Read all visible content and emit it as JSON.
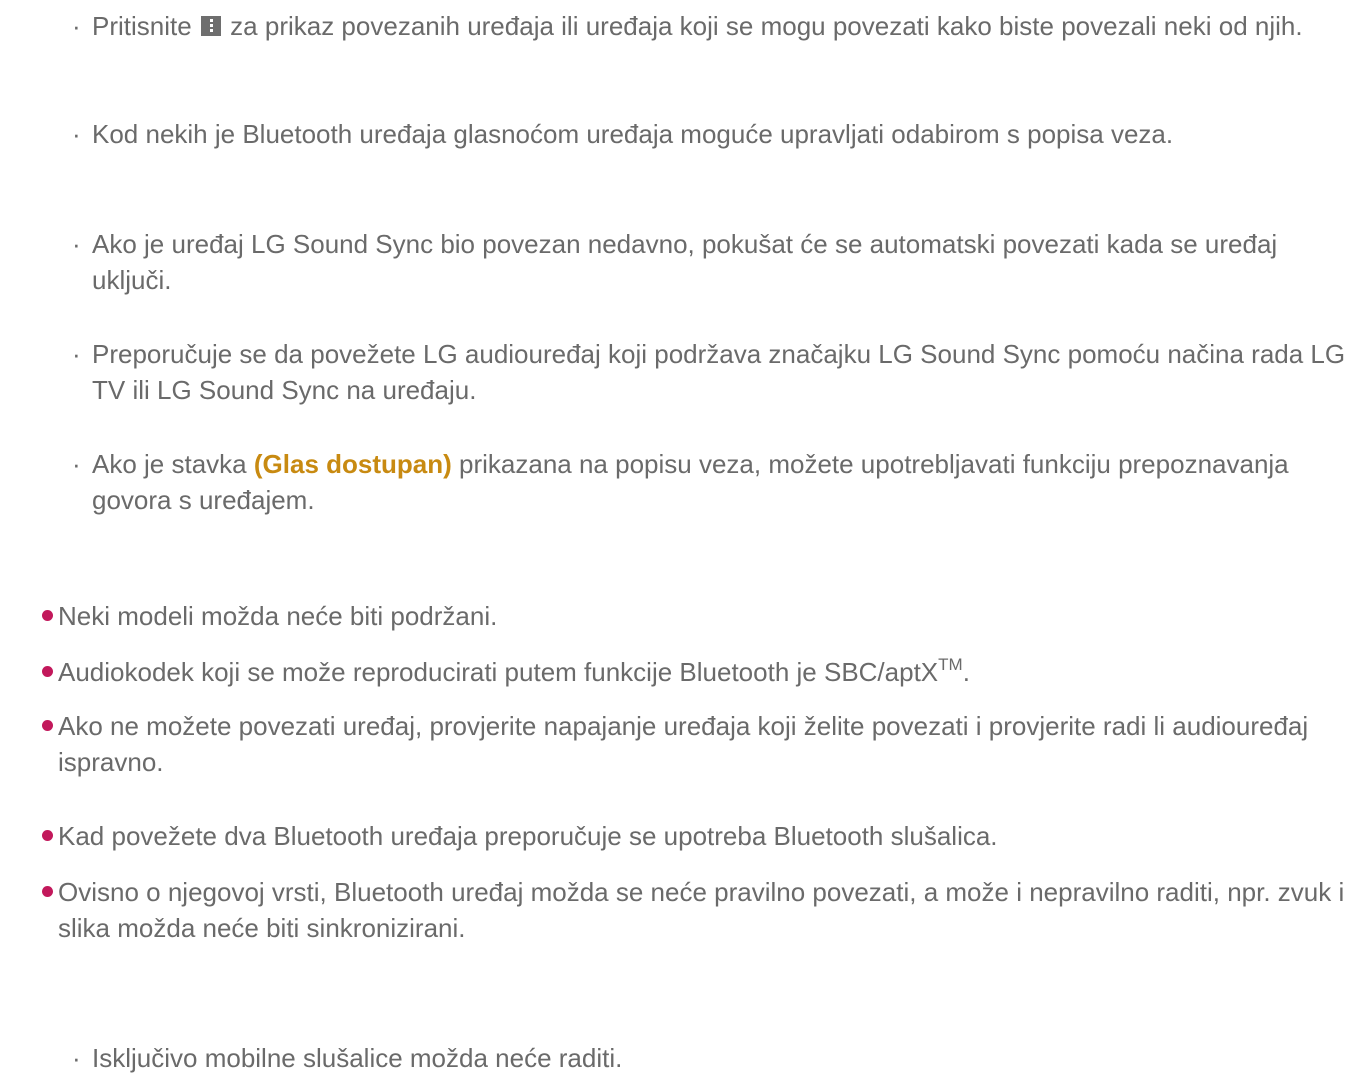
{
  "sub_items_top": [
    {
      "text_before": "Pritisnite",
      "icon": "more-menu-icon",
      "text_after": "za prikaz povezanih uređaja ili uređaja koji se mogu povezati kako biste povezali neki od njih."
    },
    {
      "text": "Kod nekih je Bluetooth uređaja glasnoćom uređaja moguće upravljati odabirom s popisa veza."
    },
    {
      "text": "Ako je uređaj LG Sound Sync bio povezan nedavno, pokušat će se automatski povezati kada se uređaj uključi."
    },
    {
      "text": "Preporučuje se da povežete LG audiouređaj koji podržava značajku LG Sound Sync pomoću načina rada LG TV ili LG Sound Sync na uređaju."
    },
    {
      "text_before": "Ako je stavka",
      "highlight": "(Glas dostupan)",
      "text_after": "prikazana na popisu veza, možete upotrebljavati funkciju prepoznavanja govora s uređajem."
    }
  ],
  "bullet_items": [
    {
      "text": "Neki modeli možda neće biti podržani."
    },
    {
      "text_before": "Audiokodek koji se može reproducirati putem funkcije Bluetooth je SBC/aptX",
      "sup": "TM",
      "text_after": "."
    },
    {
      "text": "Ako ne možete povezati uređaj, provjerite napajanje uređaja koji želite povezati i provjerite radi li audiouređaj ispravno."
    },
    {
      "text": "Kad povežete dva Bluetooth uređaja preporučuje se upotreba Bluetooth slušalica."
    },
    {
      "text": "Ovisno o njegovoj vrsti, Bluetooth uređaj možda se neće pravilno povezati, a može i nepravilno raditi, npr. zvuk i slika možda neće biti sinkronizirani."
    }
  ],
  "sub_items_bottom": [
    {
      "text": "Isključivo mobilne slušalice možda neće raditi."
    }
  ],
  "colors": {
    "text": "#6a6a6a",
    "bullet": "#c2185b",
    "highlight": "#c88a11"
  }
}
